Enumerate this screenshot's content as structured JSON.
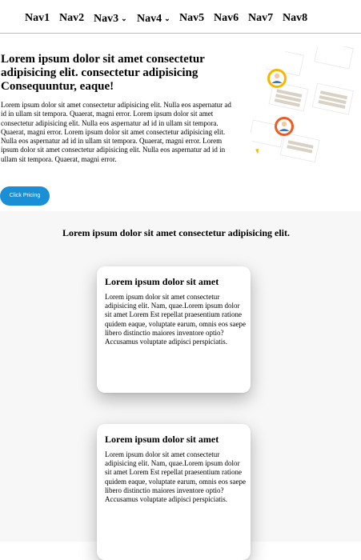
{
  "nav": {
    "items": [
      {
        "label": "Nav1",
        "has_dropdown": false
      },
      {
        "label": "Nav2",
        "has_dropdown": false
      },
      {
        "label": "Nav3",
        "has_dropdown": true
      },
      {
        "label": "Nav4",
        "has_dropdown": true
      },
      {
        "label": "Nav5",
        "has_dropdown": false
      },
      {
        "label": "Nav6",
        "has_dropdown": false
      },
      {
        "label": "Nav7",
        "has_dropdown": false
      },
      {
        "label": "Nav8",
        "has_dropdown": false
      }
    ],
    "dropdown_icon": "chevron-down-icon"
  },
  "hero": {
    "title": "Lorem ipsum dolor sit amet consectetur adipisicing elit. consectetur adipisicing Consequuntur, eaque!",
    "paragraph": "Lorem ipsum dolor sit amet consectetur adipisicing elit. Nulla eos aspernatur ad id in ullam sit tempora. Quaerat, magni error. Lorem ipsum dolor sit amet consectetur adipisicing elit. Nulla eos aspernatur ad id in ullam sit tempora. Quaerat, magni error. Lorem ipsum dolor sit amet consectetur adipisicing elit. Nulla eos aspernatur ad id in ullam sit tempora. Quaerat, magni error. Lorem ipsum dolor sit amet consectetur adipisicing elit. Nulla eos aspernatur ad id in ullam sit tempora. Quaerat, magni error.",
    "button_label": "Click Pricing",
    "button_color": "#1a8fd6"
  },
  "section": {
    "heading": "Lorem ipsum dolor sit amet consectetur adipisicing elit.",
    "background": "#f7f7f7",
    "cards": [
      {
        "title": "Lorem ipsum dolor sit amet",
        "text": "Lorem ipsum dolor sit amet consectetur adipisicing elit. Nam, quae.Lorem ipsum dolor sit amet Lorem Est repellat praesentium ratione quidem eaque, voluptate earum, omnis eos saepe libero distinctio maiores inventore optio? Accusamus voluptate adipisci perspiciatis."
      },
      {
        "title": "Lorem ipsum dolor sit amet",
        "text": "Lorem ipsum dolor sit amet consectetur adipisicing elit. Nam, quae.Lorem ipsum dolor sit amet Lorem Est repellat praesentium ratione quidem eaque, voluptate earum, omnis eos saepe libero distinctio maiores inventore optio? Accusamus voluptate adipisci perspiciatis."
      }
    ]
  }
}
